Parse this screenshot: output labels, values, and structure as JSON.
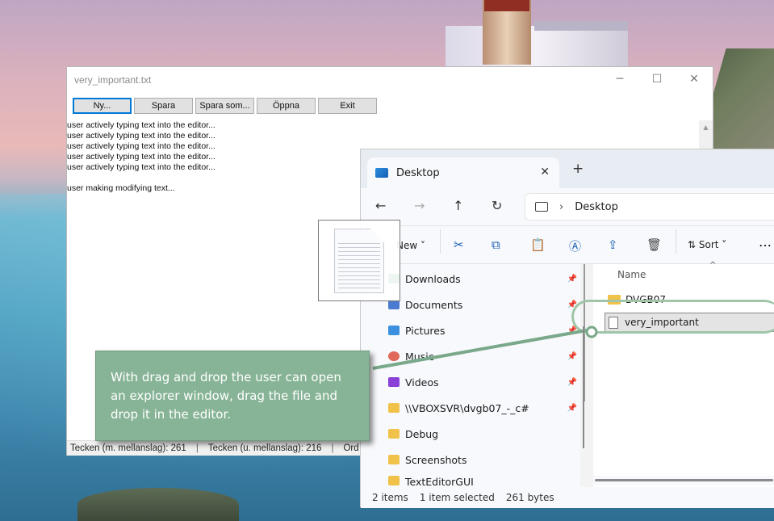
{
  "editor": {
    "title": "very_important.txt",
    "window_controls": [
      "─",
      "☐",
      "✕"
    ],
    "toolbar": {
      "new": "Ny...",
      "save": "Spara",
      "save_as": "Spara som...",
      "open": "Öppna",
      "exit": "Exit"
    },
    "lines": [
      "user actively typing text into the editor...",
      "user actively typing text into the editor...",
      "user actively typing text into the editor...",
      "user actively typing text into the editor...",
      "user actively typing text into the editor...",
      "",
      "user making modifying text..."
    ],
    "status": {
      "chars_with_spaces": "Tecken (m. mellanslag): 261",
      "chars_without_spaces": "Tecken (u. mellanslag): 216",
      "words_truncated": "Ord"
    }
  },
  "explorer": {
    "tab_title": "Desktop",
    "address": "Desktop",
    "commands": {
      "new": "New",
      "sort": "Sort"
    },
    "sidebar": [
      {
        "label": "Downloads",
        "icon": "download-icon",
        "pinned": true
      },
      {
        "label": "Documents",
        "icon": "documents-icon",
        "pinned": true
      },
      {
        "label": "Pictures",
        "icon": "pictures-icon",
        "pinned": true
      },
      {
        "label": "Music",
        "icon": "music-icon",
        "pinned": true
      },
      {
        "label": "Videos",
        "icon": "videos-icon",
        "pinned": true
      },
      {
        "label": "\\\\VBOXSVR\\dvgb07_-_c#",
        "icon": "folder-icon",
        "pinned": true
      },
      {
        "label": "Debug",
        "icon": "folder-icon",
        "pinned": false
      },
      {
        "label": "Screenshots",
        "icon": "folder-icon",
        "pinned": false
      },
      {
        "label": "TextEditorGUI",
        "icon": "folder-icon",
        "pinned": false
      }
    ],
    "column_header": "Name",
    "files": [
      {
        "name": "DVGB07",
        "type": "folder-shortcut"
      },
      {
        "name": "very_important",
        "type": "text",
        "selected": true
      }
    ],
    "status": {
      "items": "2 items",
      "selection": "1 item selected",
      "size": "261 bytes"
    }
  },
  "annotation": {
    "text": "With drag and drop the user can open an explorer window, drag the file and drop it in the editor.",
    "color": "#87b496"
  }
}
